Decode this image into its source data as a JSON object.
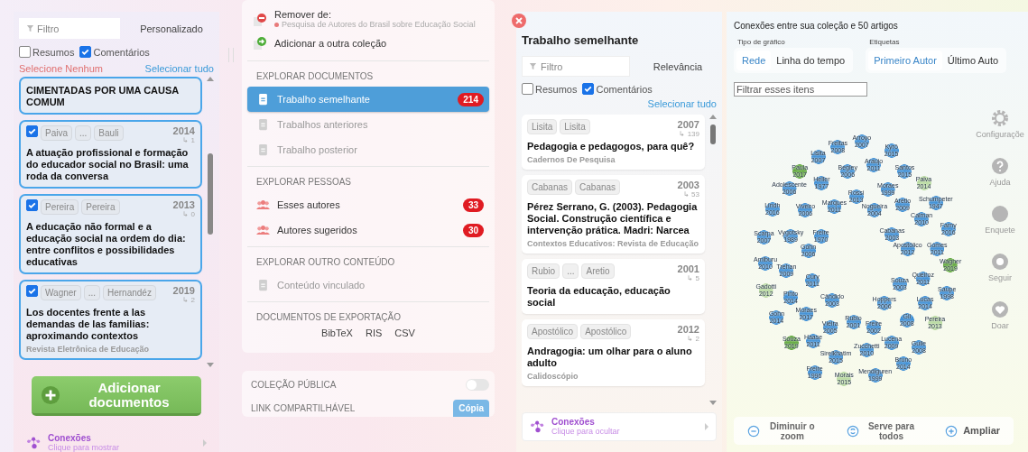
{
  "collection_panel": {
    "filter": {
      "placeholder": "Filtro"
    },
    "sort": "Personalizado",
    "checkboxes": [
      {
        "label": "Resumos",
        "checked": false
      },
      {
        "label": "Comentários",
        "checked": true
      }
    ],
    "select_none": "Selecione Nenhum",
    "select_all": "Selecionar tudo",
    "papers": [
      {
        "title": "CIMENTADAS POR UMA CAUSA COMUM"
      },
      {
        "checked": true,
        "authors": [
          "Paiva",
          "...",
          "Bauli"
        ],
        "year": "2014",
        "citations": "↳ 1",
        "title": "A atuação profissional e formação do educador social no Brasil: uma roda da conversa"
      },
      {
        "checked": true,
        "authors": [
          "Pereira",
          "Pereira"
        ],
        "year": "2013",
        "citations": "↳ 0",
        "title": "A educação não formal e a educação social na ordem do dia: entre conflitos e possibilidades educativas"
      },
      {
        "checked": true,
        "authors": [
          "Wagner",
          "...",
          "Hernandéz"
        ],
        "year": "2019",
        "citations": "↳ 2",
        "title": "Los docentes frente a las demandas de las familias: aproximando contextos",
        "journal": "Revista Eletrônica de Educação"
      }
    ],
    "add_button": "Adicionar documentos",
    "connections": {
      "title": "Conexões",
      "subtitle": "Clique para mostrar"
    }
  },
  "actions_panel": {
    "remove": {
      "label": "Remover de:",
      "collection": "Pesquisa de Autores do Brasil sobre Educação Social"
    },
    "add_to": "Adicionar a outra coleção",
    "sections": [
      {
        "heading": "EXPLORAR DOCUMENTOS",
        "items": [
          {
            "kind": "document",
            "label": "Trabalho semelhante",
            "count": "214",
            "selected": true,
            "disabled": false
          },
          {
            "kind": "document",
            "label": "Trabalhos anteriores",
            "selected": false,
            "disabled": true
          },
          {
            "kind": "document",
            "label": "Trabalho posterior",
            "selected": false,
            "disabled": true
          }
        ]
      },
      {
        "heading": "EXPLORAR PESSOAS",
        "items": [
          {
            "kind": "people",
            "label": "Esses autores",
            "count": "33",
            "selected": false,
            "disabled": false
          },
          {
            "kind": "people",
            "label": "Autores sugeridos",
            "count": "30",
            "selected": false,
            "disabled": false
          }
        ]
      },
      {
        "heading": "EXPLORAR OUTRO CONTEÚDO",
        "items": [
          {
            "kind": "document",
            "label": "Conteúdo vinculado",
            "selected": false,
            "disabled": true
          }
        ]
      }
    ],
    "export": {
      "heading": "DOCUMENTOS DE EXPORTAÇÃO",
      "formats": [
        "BibTeX",
        "RIS",
        "CSV"
      ]
    },
    "public": {
      "label": "COLEÇÃO PÚBLICA",
      "on": false
    },
    "share": {
      "label": "LINK COMPARTILHÁVEL",
      "button": "Cópia"
    }
  },
  "similar_panel": {
    "title": "Trabalho semelhante",
    "filter": {
      "placeholder": "Filtro"
    },
    "sort": "Relevância",
    "checkboxes": [
      {
        "label": "Resumos",
        "checked": false
      },
      {
        "label": "Comentários",
        "checked": true
      }
    ],
    "select_all": "Selecionar tudo",
    "papers": [
      {
        "authors": [
          "Lisita",
          "Lisita"
        ],
        "year": "2007",
        "citations": "↳ 139",
        "title": "Pedagogia e pedagogos, para quê?",
        "journal": "Cadernos De Pesquisa"
      },
      {
        "authors": [
          "Cabanas",
          "Cabanas"
        ],
        "year": "2003",
        "citations": "↳ 53",
        "title": "Pérez Serrano, G. (2003). Pedagogia Social. Construção científica e intervenção prática. Madri: Narcea",
        "journal": "Contextos Educativos: Revista de Educação"
      },
      {
        "authors": [
          "Rubio",
          "...",
          "Aretio"
        ],
        "year": "2001",
        "citations": "↳ 5",
        "title": "Teoria da educação, educação social"
      },
      {
        "authors": [
          "Apostólico",
          "Apostólico"
        ],
        "year": "2012",
        "citations": "↳ 2",
        "title": "Andragogia: um olhar para o aluno adulto",
        "journal": "Calidoscópio"
      }
    ],
    "connections": {
      "title": "Conexões",
      "subtitle": "Clique para ocultar"
    }
  },
  "graph_panel": {
    "title": "Conexões entre sua coleção e 50 artigos",
    "graph_type": {
      "label": "Tipo de gráfico",
      "options": [
        {
          "label": "Rede",
          "selected": true
        },
        {
          "label": "Linha do tempo",
          "selected": false
        }
      ]
    },
    "labels": {
      "label": "Etiquetas",
      "options": [
        {
          "label": "Primeiro Autor",
          "selected": true
        },
        {
          "label": "Último Auto",
          "selected": false
        }
      ]
    },
    "filter": {
      "placeholder": "Filtrar esses itens"
    },
    "nodes": [
      {
        "name": "Freitas",
        "year": "2008",
        "color": "#3d8fd6"
      },
      {
        "name": "Arroyo",
        "year": "2007",
        "color": "#3d8fd6"
      },
      {
        "name": "Kyrö",
        "year": "2015",
        "color": "#3d8fd6"
      },
      {
        "name": "Lisita",
        "year": "2007",
        "color": "#3d8fd6"
      },
      {
        "name": "Paula",
        "year": "2017",
        "color": "#5fa83a"
      },
      {
        "name": "Begley",
        "year": "2006",
        "color": "#3d8fd6"
      },
      {
        "name": "Araújo",
        "year": "2011",
        "color": "#3d8fd6"
      },
      {
        "name": "Santos",
        "year": "2015",
        "color": "#3d8fd6"
      },
      {
        "name": "Adolescente",
        "year": "2006",
        "color": "#3d8fd6"
      },
      {
        "name": "Heller",
        "year": "1977",
        "color": "#3d8fd6"
      },
      {
        "name": "Moraes",
        "year": "1999",
        "color": "#3d8fd6"
      },
      {
        "name": "Paiva",
        "year": "2014",
        "color": "#b9dca0"
      },
      {
        "name": "Rossi",
        "year": "2013",
        "color": "#3d8fd6"
      },
      {
        "name": "Lindh",
        "year": "2016",
        "color": "#3d8fd6"
      },
      {
        "name": "Viveiro",
        "year": "2006",
        "color": "#3d8fd6"
      },
      {
        "name": "Marques",
        "year": "2011",
        "color": "#3d8fd6"
      },
      {
        "name": "Nogueira",
        "year": "2004",
        "color": "#3d8fd6"
      },
      {
        "name": "Aretio",
        "year": "2009",
        "color": "#3d8fd6"
      },
      {
        "name": "Schumpeter",
        "year": "1947",
        "color": "#3d8fd6"
      },
      {
        "name": "Calman",
        "year": "2010",
        "color": "#3d8fd6"
      },
      {
        "name": "Farny",
        "year": "2016",
        "color": "#3d8fd6"
      },
      {
        "name": "Scarpa",
        "year": "2007",
        "color": "#3d8fd6"
      },
      {
        "name": "Vygotsky",
        "year": "1989",
        "color": "#3d8fd6"
      },
      {
        "name": "Freire",
        "year": "1970",
        "color": "#3d8fd6"
      },
      {
        "name": "Gohn",
        "year": "2006",
        "color": "#3d8fd6"
      },
      {
        "name": "Cabanas",
        "year": "2003",
        "color": "#3d8fd6"
      },
      {
        "name": "Apostólico",
        "year": "2012",
        "color": "#3d8fd6"
      },
      {
        "name": "Gomes",
        "year": "2011",
        "color": "#3d8fd6"
      },
      {
        "name": "Amiburu",
        "year": "2010",
        "color": "#3d8fd6"
      },
      {
        "name": "Wagner",
        "year": "2019",
        "color": "#5fa83a"
      },
      {
        "name": "Trehan",
        "year": "2009",
        "color": "#3d8fd6"
      },
      {
        "name": "Cury",
        "year": "2011",
        "color": "#3d8fd6"
      },
      {
        "name": "Queiroz",
        "year": "2011",
        "color": "#3d8fd6"
      },
      {
        "name": "Souza",
        "year": "2003",
        "color": "#3d8fd6"
      },
      {
        "name": "Gadotti",
        "year": "2012",
        "color": "#b9dca0"
      },
      {
        "name": "Saupe",
        "year": "1998",
        "color": "#3d8fd6"
      },
      {
        "name": "Pinto",
        "year": "2014",
        "color": "#3d8fd6"
      },
      {
        "name": "Cândido",
        "year": "2003",
        "color": "#3d8fd6"
      },
      {
        "name": "Hoppers",
        "year": "2006",
        "color": "#3d8fd6"
      },
      {
        "name": "Lucas",
        "year": "2014",
        "color": "#3d8fd6"
      },
      {
        "name": "Gohn",
        "year": "2014",
        "color": "#3d8fd6"
      },
      {
        "name": "Moraes",
        "year": "2017",
        "color": "#3d8fd6"
      },
      {
        "name": "Rubio",
        "year": "2001",
        "color": "#3d8fd6"
      },
      {
        "name": "Gil",
        "year": "2008",
        "color": "#3d8fd6"
      },
      {
        "name": "Pereira",
        "year": "2013",
        "color": "#b9dca0"
      },
      {
        "name": "Vieira",
        "year": "2005",
        "color": "#3d8fd6"
      },
      {
        "name": "Freire",
        "year": "2002",
        "color": "#3d8fd6"
      },
      {
        "name": "Souza",
        "year": "2019",
        "color": "#5fa83a"
      },
      {
        "name": "Haase",
        "year": "2011",
        "color": "#3d8fd6"
      },
      {
        "name": "Lucena",
        "year": "2009",
        "color": "#3d8fd6"
      },
      {
        "name": "Guile",
        "year": "2008",
        "color": "#3d8fd6"
      },
      {
        "name": "Sirelkhatim",
        "year": "2015",
        "color": "#3d8fd6"
      },
      {
        "name": "Zucchetti",
        "year": "2010",
        "color": "#3d8fd6"
      },
      {
        "name": "Bruno",
        "year": "2014",
        "color": "#3d8fd6"
      },
      {
        "name": "Freire",
        "year": "1996",
        "color": "#3d8fd6"
      },
      {
        "name": "Morais",
        "year": "2015",
        "color": "#b9dca0"
      },
      {
        "name": "Mendiguren",
        "year": "1999",
        "color": "#3d8fd6"
      }
    ],
    "side_actions": [
      {
        "kind": "settings",
        "label": "Configuraçõe"
      },
      {
        "kind": "help",
        "label": "Ajuda"
      },
      {
        "kind": "poll",
        "label": "Enquete"
      },
      {
        "kind": "follow",
        "label": "Seguir"
      },
      {
        "kind": "donate",
        "label": "Doar"
      }
    ],
    "zoom_controls": [
      {
        "kind": "zoom-out",
        "label": "Diminuir o zoom"
      },
      {
        "kind": "fit",
        "label": "Serve para todos"
      },
      {
        "kind": "zoom-in",
        "label": "Ampliar"
      }
    ]
  }
}
